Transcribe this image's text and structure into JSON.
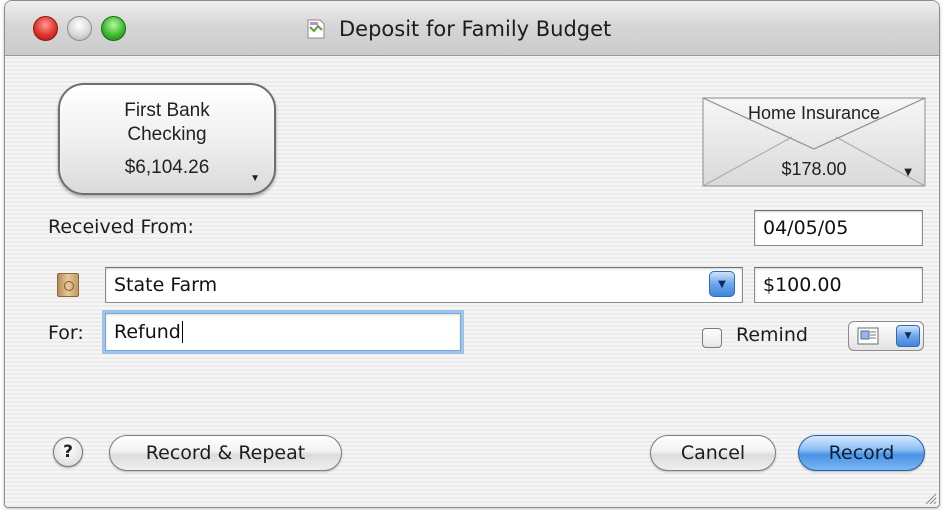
{
  "window": {
    "title": "Deposit for Family Budget",
    "title_icon": "budget-document-icon"
  },
  "account": {
    "name_line1": "First Bank",
    "name_line2": "Checking",
    "balance": "$6,104.26",
    "arrow_icon": "dropdown-arrow-icon"
  },
  "envelope": {
    "name": "Home Insurance",
    "amount": "$178.00",
    "arrow_icon": "dropdown-arrow-icon"
  },
  "form": {
    "received_from_label": "Received From:",
    "date": "04/05/05",
    "payee": "State Farm",
    "amount": "$100.00",
    "for_label": "For:",
    "for_value": "Refund",
    "remind_label": "Remind",
    "remind_checked": false
  },
  "buttons": {
    "help": "?",
    "record_repeat": "Record & Repeat",
    "cancel": "Cancel",
    "record": "Record"
  },
  "colors": {
    "default_button": "#4a94e6",
    "focus_ring": "#9ec4ec"
  }
}
